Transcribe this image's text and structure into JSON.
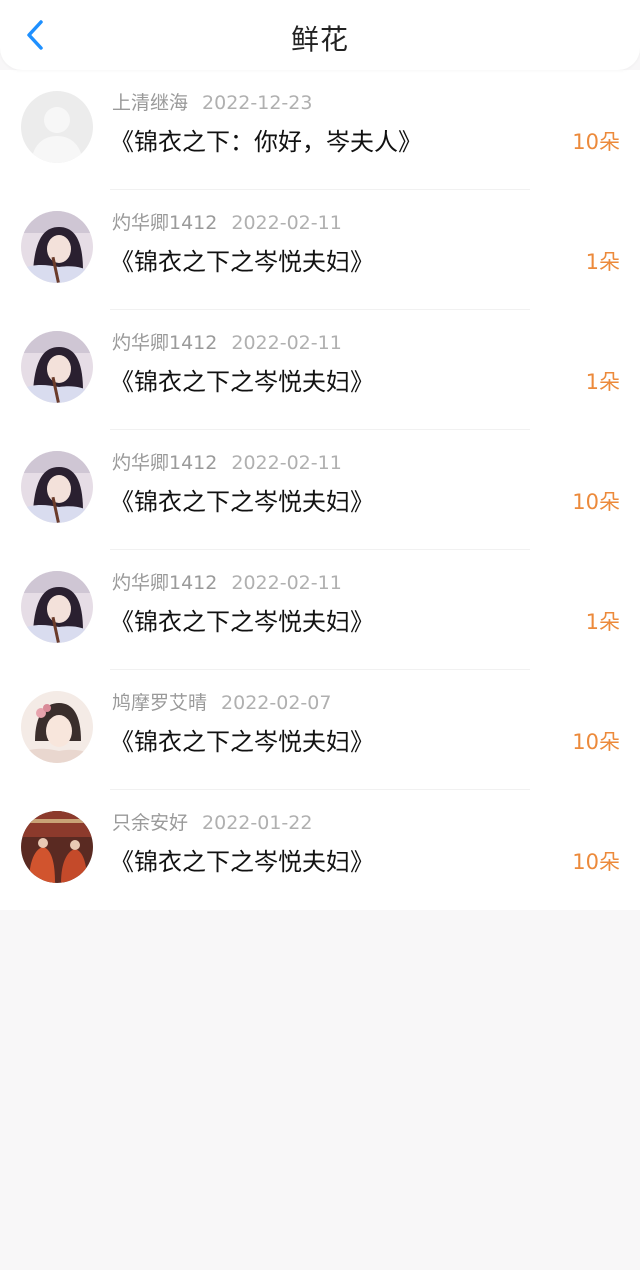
{
  "header": {
    "title": "鲜花",
    "back_icon": "chevron-left-icon",
    "accent": "#1e90ff"
  },
  "colors": {
    "count": "#ec8a3b",
    "username": "#9a9a9a",
    "date": "#b0b0b0"
  },
  "records": [
    {
      "username": "上清继海",
      "date": "2022-12-23",
      "title": "《锦衣之下：你好，岑夫人》",
      "count": "10朵",
      "avatar": "default-avatar"
    },
    {
      "username": "灼华卿1412",
      "date": "2022-02-11",
      "title": "《锦衣之下之岑悦夫妇》",
      "count": "1朵",
      "avatar": "girl-photo-avatar"
    },
    {
      "username": "灼华卿1412",
      "date": "2022-02-11",
      "title": "《锦衣之下之岑悦夫妇》",
      "count": "1朵",
      "avatar": "girl-photo-avatar"
    },
    {
      "username": "灼华卿1412",
      "date": "2022-02-11",
      "title": "《锦衣之下之岑悦夫妇》",
      "count": "10朵",
      "avatar": "girl-photo-avatar"
    },
    {
      "username": "灼华卿1412",
      "date": "2022-02-11",
      "title": "《锦衣之下之岑悦夫妇》",
      "count": "1朵",
      "avatar": "girl-photo-avatar"
    },
    {
      "username": "鸠摩罗艾晴",
      "date": "2022-02-07",
      "title": "《锦衣之下之岑悦夫妇》",
      "count": "10朵",
      "avatar": "painted-lady-avatar"
    },
    {
      "username": "只余安好",
      "date": "2022-01-22",
      "title": "《锦衣之下之岑悦夫妇》",
      "count": "10朵",
      "avatar": "red-robes-avatar"
    }
  ]
}
